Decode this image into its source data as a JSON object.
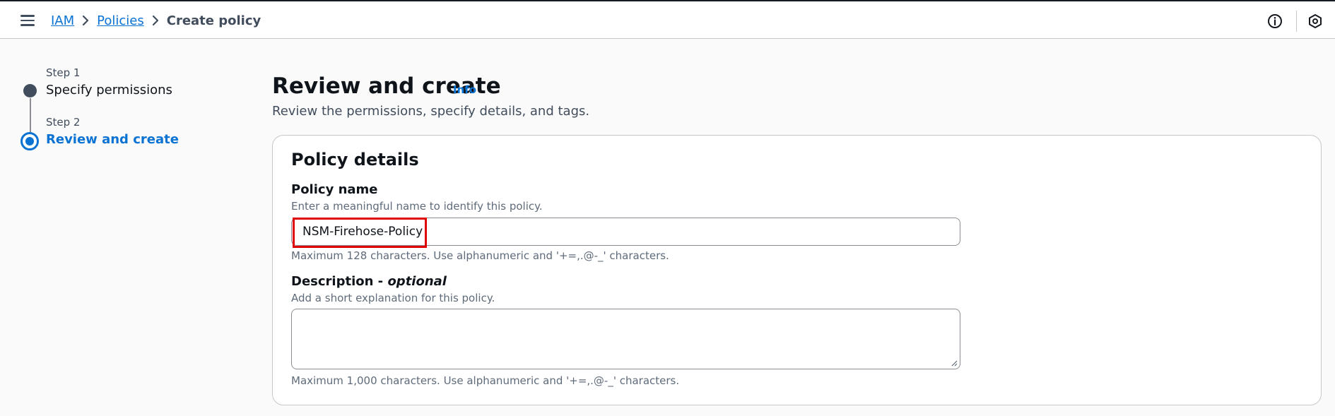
{
  "breadcrumb": {
    "items": [
      "IAM",
      "Policies"
    ],
    "current": "Create policy"
  },
  "wizard": {
    "steps": [
      {
        "step_label": "Step 1",
        "title": "Specify permissions",
        "state": "completed"
      },
      {
        "step_label": "Step 2",
        "title": "Review and create",
        "state": "active"
      }
    ]
  },
  "page": {
    "title": "Review and create",
    "info_link": "Info",
    "description": "Review the permissions, specify details, and tags."
  },
  "policy_details": {
    "heading": "Policy details",
    "name": {
      "label": "Policy name",
      "hint": "Enter a meaningful name to identify this policy.",
      "value": "NSM-Firehose-Policy",
      "constraint": "Maximum 128 characters. Use alphanumeric and '+=,.@-_' characters."
    },
    "description": {
      "label": "Description - ",
      "label_optional": "optional",
      "hint": "Add a short explanation for this policy.",
      "value": "",
      "constraint": "Maximum 1,000 characters. Use alphanumeric and '+=,.@-_' characters."
    }
  },
  "icons": {
    "menu": "hamburger-menu-icon",
    "info": "info-circle-icon",
    "settings": "hexagon-settings-icon"
  },
  "colors": {
    "link": "#0972d3",
    "highlight": "#e00000"
  }
}
